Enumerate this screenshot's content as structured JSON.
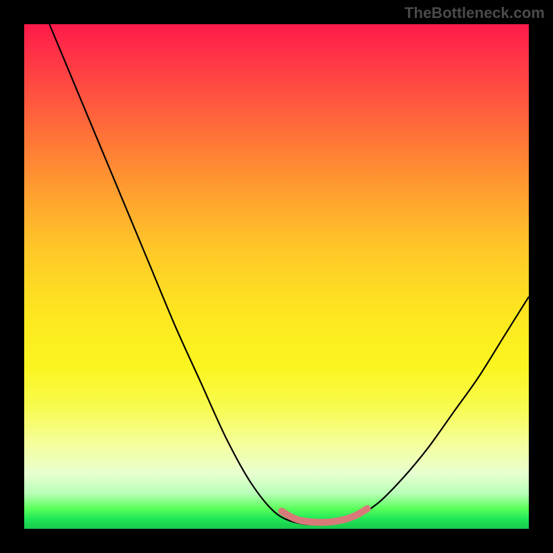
{
  "watermark": "TheBottleneck.com",
  "chart_data": {
    "type": "line",
    "title": "",
    "xlabel": "",
    "ylabel": "",
    "xlim": [
      0,
      100
    ],
    "ylim": [
      0,
      100
    ],
    "grid": false,
    "legend": false,
    "gradient_stops": [
      {
        "pos": 0,
        "color": "#ff1a4a"
      },
      {
        "pos": 20,
        "color": "#ff6a3a"
      },
      {
        "pos": 45,
        "color": "#ffc928"
      },
      {
        "pos": 68,
        "color": "#faf520"
      },
      {
        "pos": 89,
        "color": "#e8ffd0"
      },
      {
        "pos": 100,
        "color": "#18c84a"
      }
    ],
    "series": [
      {
        "name": "bottleneck-curve",
        "color": "#000000",
        "points": [
          {
            "x": 5,
            "y": 100
          },
          {
            "x": 10,
            "y": 88
          },
          {
            "x": 15,
            "y": 76
          },
          {
            "x": 20,
            "y": 64
          },
          {
            "x": 25,
            "y": 52
          },
          {
            "x": 30,
            "y": 40
          },
          {
            "x": 35,
            "y": 29
          },
          {
            "x": 40,
            "y": 18
          },
          {
            "x": 45,
            "y": 9
          },
          {
            "x": 50,
            "y": 3
          },
          {
            "x": 55,
            "y": 1
          },
          {
            "x": 60,
            "y": 1
          },
          {
            "x": 65,
            "y": 2
          },
          {
            "x": 70,
            "y": 5
          },
          {
            "x": 75,
            "y": 10
          },
          {
            "x": 80,
            "y": 16
          },
          {
            "x": 85,
            "y": 23
          },
          {
            "x": 90,
            "y": 30
          },
          {
            "x": 95,
            "y": 38
          },
          {
            "x": 100,
            "y": 46
          }
        ]
      },
      {
        "name": "optimal-zone-marker",
        "color": "#d97a7a",
        "stroke_width": 10,
        "points": [
          {
            "x": 51,
            "y": 3.5
          },
          {
            "x": 53,
            "y": 2.3
          },
          {
            "x": 55,
            "y": 1.6
          },
          {
            "x": 58,
            "y": 1.3
          },
          {
            "x": 61,
            "y": 1.4
          },
          {
            "x": 64,
            "y": 2.0
          },
          {
            "x": 66,
            "y": 2.8
          },
          {
            "x": 68,
            "y": 4.0
          }
        ]
      }
    ]
  }
}
